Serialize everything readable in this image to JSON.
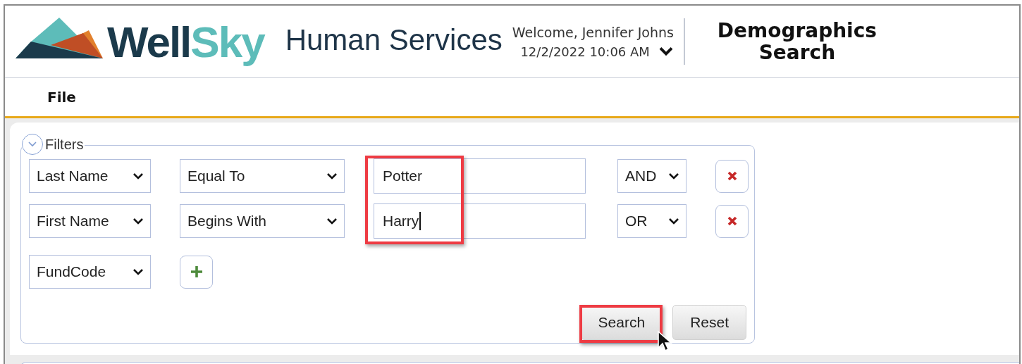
{
  "header": {
    "brand": [
      {
        "text": "Well",
        "color": "#1b3a4b"
      },
      {
        "text": "Sky",
        "color": "#5dbcb9"
      }
    ],
    "product": "Human Services",
    "welcome": "Welcome, Jennifer Johns",
    "datetime": "12/2/2022 10:06 AM",
    "page_title": "Demographics Search"
  },
  "menu": [
    {
      "label": "File"
    }
  ],
  "filters": {
    "legend": "Filters",
    "expanded": true,
    "rows": [
      {
        "kind": "condition",
        "field": "Last Name",
        "operator": "Equal To",
        "value": "Potter",
        "focused": false,
        "highlighted": true,
        "join": "AND"
      },
      {
        "kind": "condition",
        "field": "First Name",
        "operator": "Begins With",
        "value": "Harry",
        "focused": true,
        "highlighted": true,
        "join": "OR"
      },
      {
        "kind": "new",
        "field": "FundCode"
      }
    ],
    "buttons": [
      {
        "label": "Search",
        "highlighted": true,
        "hovered": true
      },
      {
        "label": "Reset",
        "highlighted": false,
        "hovered": false
      }
    ]
  }
}
